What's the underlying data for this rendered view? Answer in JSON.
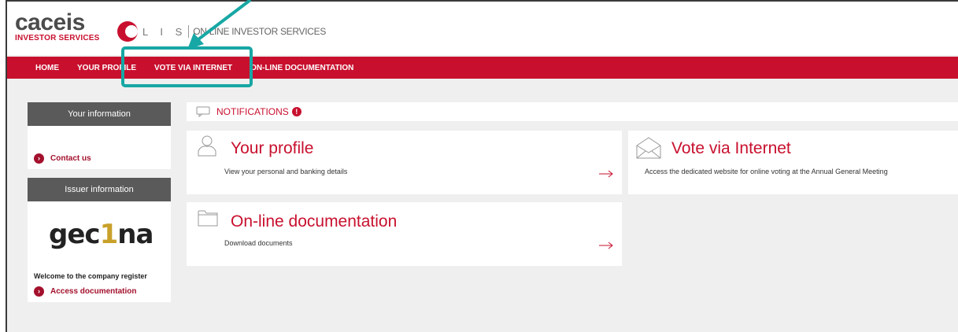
{
  "header": {
    "brand_name": "caceis",
    "brand_sub": "INVESTOR SERVICES",
    "olis_letters": "L I S",
    "olis_title": "ON LINE INVESTOR SERVICES"
  },
  "nav": {
    "items": [
      {
        "label": "HOME"
      },
      {
        "label": "YOUR PROFILE"
      },
      {
        "label": "VOTE VIA INTERNET"
      },
      {
        "label": "ON-LINE DOCUMENTATION"
      }
    ]
  },
  "sidebar": {
    "your_info_title": "Your information",
    "contact_label": "Contact us",
    "issuer_info_title": "Issuer information",
    "issuer_logo": {
      "pre": "gec",
      "one": "1",
      "post": "na"
    },
    "welcome_text": "Welcome to the company register",
    "access_doc_label": "Access documentation"
  },
  "notifications": {
    "label": "NOTIFICATIONS",
    "badge": "!"
  },
  "cards": {
    "profile": {
      "title": "Your profile",
      "desc": "View your personal and banking details",
      "icon": "person-icon"
    },
    "vote": {
      "title": "Vote via Internet",
      "desc": "Access the dedicated website for online voting at the Annual General Meeting",
      "icon": "envelope-icon"
    },
    "docs": {
      "title": "On-line documentation",
      "desc": "Download documents",
      "icon": "folder-icon"
    }
  },
  "colors": {
    "brand_red": "#c8102e",
    "dark_grey": "#5a5a5a",
    "highlight_teal": "#17a7a4"
  }
}
